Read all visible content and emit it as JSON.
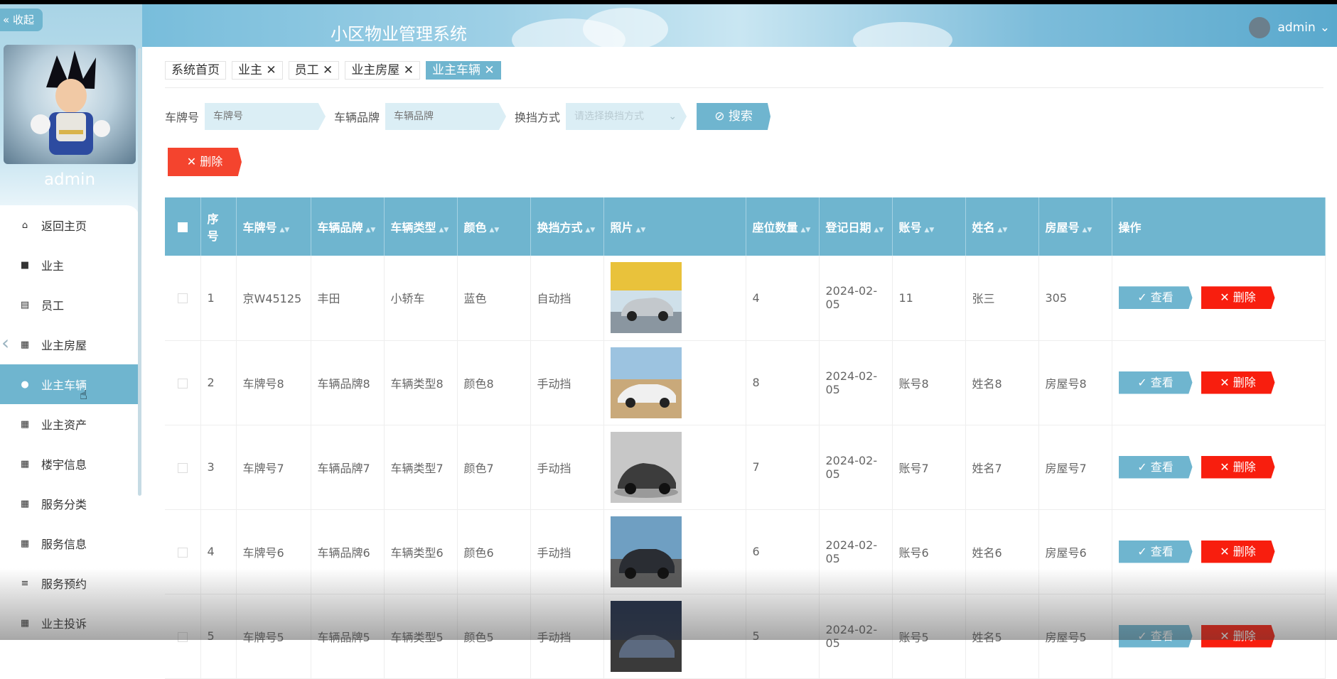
{
  "sidebar": {
    "collapse_label": "« 收起",
    "user_name": "admin",
    "items": [
      {
        "label": "返回主页",
        "icon": "home-icon",
        "active": false
      },
      {
        "label": "业主",
        "icon": "briefcase-icon",
        "active": false
      },
      {
        "label": "员工",
        "icon": "clipboard-icon",
        "active": false
      },
      {
        "label": "业主房屋",
        "icon": "grid-icon",
        "active": false
      },
      {
        "label": "业主车辆",
        "icon": "bulb-icon",
        "active": true
      },
      {
        "label": "业主资产",
        "icon": "grid-icon",
        "active": false
      },
      {
        "label": "楼宇信息",
        "icon": "grid-icon",
        "active": false
      },
      {
        "label": "服务分类",
        "icon": "grid-icon",
        "active": false
      },
      {
        "label": "服务信息",
        "icon": "grid-icon",
        "active": false
      },
      {
        "label": "服务预约",
        "icon": "list-icon",
        "active": false
      },
      {
        "label": "业主投诉",
        "icon": "grid-icon",
        "active": false
      }
    ]
  },
  "header": {
    "title": "小区物业管理系统",
    "user": "admin"
  },
  "tags": [
    {
      "label": "系统首页",
      "closable": false,
      "active": false
    },
    {
      "label": "业主",
      "closable": true,
      "active": false
    },
    {
      "label": "员工",
      "closable": true,
      "active": false
    },
    {
      "label": "业主房屋",
      "closable": true,
      "active": false
    },
    {
      "label": "业主车辆",
      "closable": true,
      "active": true
    }
  ],
  "search": {
    "plate_label": "车牌号",
    "plate_placeholder": "车牌号",
    "brand_label": "车辆品牌",
    "brand_placeholder": "车辆品牌",
    "gear_label": "换挡方式",
    "gear_placeholder": "请选择换挡方式",
    "search_button": "搜索"
  },
  "actions": {
    "delete_button": "删除"
  },
  "table": {
    "columns": [
      "序号",
      "车牌号",
      "车辆品牌",
      "车辆类型",
      "颜色",
      "换挡方式",
      "照片",
      "座位数量",
      "登记日期",
      "账号",
      "姓名",
      "房屋号",
      "操作"
    ],
    "view_label": "查看",
    "delete_label": "删除",
    "rows": [
      {
        "no": "1",
        "plate": "京W45125",
        "brand": "丰田",
        "type": "小轿车",
        "color": "蓝色",
        "gear": "自动挡",
        "seats": "4",
        "date": "2024-02-05",
        "account": "11",
        "name": "张三",
        "house": "305"
      },
      {
        "no": "2",
        "plate": "车牌号8",
        "brand": "车辆品牌8",
        "type": "车辆类型8",
        "color": "颜色8",
        "gear": "手动挡",
        "seats": "8",
        "date": "2024-02-05",
        "account": "账号8",
        "name": "姓名8",
        "house": "房屋号8"
      },
      {
        "no": "3",
        "plate": "车牌号7",
        "brand": "车辆品牌7",
        "type": "车辆类型7",
        "color": "颜色7",
        "gear": "手动挡",
        "seats": "7",
        "date": "2024-02-05",
        "account": "账号7",
        "name": "姓名7",
        "house": "房屋号7"
      },
      {
        "no": "4",
        "plate": "车牌号6",
        "brand": "车辆品牌6",
        "type": "车辆类型6",
        "color": "颜色6",
        "gear": "手动挡",
        "seats": "6",
        "date": "2024-02-05",
        "account": "账号6",
        "name": "姓名6",
        "house": "房屋号6"
      },
      {
        "no": "5",
        "plate": "车牌号5",
        "brand": "车辆品牌5",
        "type": "车辆类型5",
        "color": "颜色5",
        "gear": "手动挡",
        "seats": "5",
        "date": "2024-02-05",
        "account": "账号5",
        "name": "姓名5",
        "house": "房屋号5"
      }
    ]
  },
  "colors": {
    "accent": "#6fb5cf",
    "danger": "#f81e0e"
  }
}
